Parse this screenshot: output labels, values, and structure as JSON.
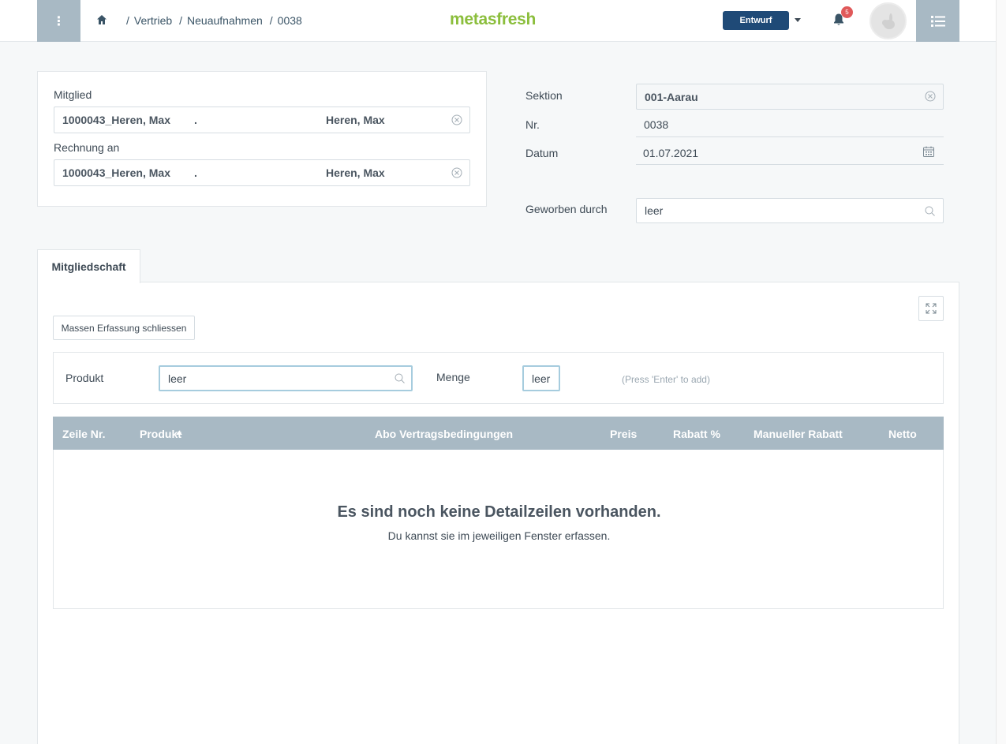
{
  "header": {
    "menu_icon_glyph": "⋮",
    "breadcrumb": [
      "Vertrieb",
      "Neuaufnahmen",
      "0038"
    ],
    "logo": "metasfresh",
    "status_button": "Entwurf",
    "notification_count": "5",
    "colors": {
      "accent": "#1f4a77",
      "logo": "#8bbe3c",
      "nav": "#a8b9c4",
      "badge": "#e0595a"
    }
  },
  "form_left": {
    "member_label": "Mitglied",
    "member_value": {
      "key": "1000043_Heren, Max",
      "dot": ".",
      "name": "Heren, Max"
    },
    "invoice_label": "Rechnung an",
    "invoice_value": {
      "key": "1000043_Heren, Max",
      "dot": ".",
      "name": "Heren, Max"
    }
  },
  "form_right": {
    "section_label": "Sektion",
    "section_value": "001-Aarau",
    "number_label": "Nr.",
    "number_value": "0038",
    "date_label": "Datum",
    "date_value": "01.07.2021",
    "recruited_label": "Geworben durch",
    "recruited_value": "leer"
  },
  "tabs": [
    {
      "label": "Mitgliedschaft",
      "active": true
    }
  ],
  "quick_entry": {
    "close_button": "Massen Erfassung schliessen",
    "product_label": "Produkt",
    "product_placeholder": "leer",
    "qty_label": "Menge",
    "qty_placeholder": "leer",
    "hint": "(Press 'Enter' to add)"
  },
  "grid": {
    "columns": [
      "Zeile Nr.",
      "Produkt",
      "Abo Vertragsbedingungen",
      "Preis",
      "Rabatt %",
      "Manueller Rabatt",
      "Netto"
    ],
    "empty_title": "Es sind noch keine Detailzeilen vorhanden.",
    "empty_subtitle": "Du kannst sie im jeweiligen Fenster erfassen."
  }
}
